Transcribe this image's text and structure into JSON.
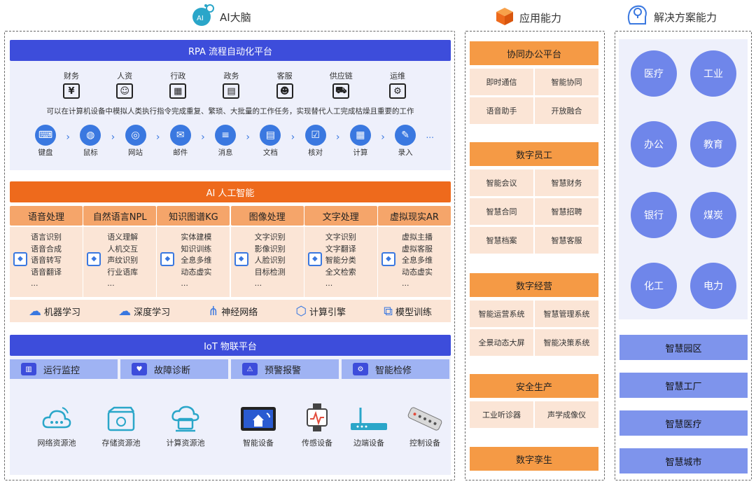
{
  "headers": {
    "ai_brain": "AI大脑",
    "app_capability": "应用能力",
    "solution_capability": "解决方案能力"
  },
  "rpa": {
    "title": "RPA 流程自动化平台",
    "categories": [
      {
        "label": "财务",
        "icon": "finance-icon"
      },
      {
        "label": "人资",
        "icon": "hr-icon"
      },
      {
        "label": "行政",
        "icon": "admin-icon"
      },
      {
        "label": "政务",
        "icon": "government-icon"
      },
      {
        "label": "客服",
        "icon": "customer-service-icon"
      },
      {
        "label": "供应链",
        "icon": "supply-chain-icon"
      },
      {
        "label": "运维",
        "icon": "ops-icon"
      }
    ],
    "description": "可以在计算机设备中模拟人类执行指令完成重复、繁琐、大批量的工作任务，实现替代人工完成枯燥且重要的工作",
    "steps": [
      {
        "label": "键盘",
        "icon": "keyboard-icon"
      },
      {
        "label": "鼠标",
        "icon": "mouse-icon"
      },
      {
        "label": "网站",
        "icon": "globe-icon"
      },
      {
        "label": "邮件",
        "icon": "mail-icon"
      },
      {
        "label": "消息",
        "icon": "message-icon"
      },
      {
        "label": "文档",
        "icon": "document-icon"
      },
      {
        "label": "核对",
        "icon": "checklist-icon"
      },
      {
        "label": "计算",
        "icon": "calculator-icon"
      },
      {
        "label": "录入",
        "icon": "entry-icon"
      }
    ],
    "ellipsis": "..."
  },
  "ai": {
    "title": "AI 人工智能",
    "columns": [
      {
        "head": "语音处理",
        "items": [
          "语言识别",
          "语音合成",
          "语音转写",
          "语音翻译",
          "..."
        ]
      },
      {
        "head": "自然语言NPL",
        "items": [
          "语义理解",
          "人机交互",
          "声纹识别",
          "行业语库",
          "..."
        ]
      },
      {
        "head": "知识图谱KG",
        "items": [
          "实体建模",
          "知识训练",
          "全息多维",
          "动态虚实",
          "..."
        ]
      },
      {
        "head": "图像处理",
        "items": [
          "文字识别",
          "影像识别",
          "人脸识别",
          "目标检测",
          "..."
        ]
      },
      {
        "head": "文字处理",
        "items": [
          "文字识别",
          "文字翻译",
          "智能分类",
          "全文检索",
          "..."
        ]
      },
      {
        "head": "虚拟现实AR",
        "items": [
          "虚拟主播",
          "虚拟客服",
          "全息多维",
          "动态虚实",
          "..."
        ]
      }
    ],
    "ml_row": [
      {
        "label": "机器学习",
        "icon": "brain-icon"
      },
      {
        "label": "深度学习",
        "icon": "deep-learning-icon"
      },
      {
        "label": "神经网络",
        "icon": "network-icon"
      },
      {
        "label": "计算引擎",
        "icon": "engine-icon"
      },
      {
        "label": "模型训练",
        "icon": "cubes-icon"
      }
    ]
  },
  "iot": {
    "title": "IoT 物联平台",
    "tabs": [
      {
        "label": "运行监控",
        "icon": "monitor-icon"
      },
      {
        "label": "故障诊断",
        "icon": "diagnosis-icon"
      },
      {
        "label": "预警报警",
        "icon": "warning-icon"
      },
      {
        "label": "智能检修",
        "icon": "repair-icon"
      }
    ],
    "devices": [
      {
        "label": "网络资源池",
        "icon": "cloud-network-icon"
      },
      {
        "label": "存储资源池",
        "icon": "storage-icon"
      },
      {
        "label": "计算资源池",
        "icon": "compute-cloud-icon"
      },
      {
        "label": "智能设备",
        "icon": "smart-device-icon"
      },
      {
        "label": "传感设备",
        "icon": "sensor-icon"
      },
      {
        "label": "边端设备",
        "icon": "router-icon"
      },
      {
        "label": "控制设备",
        "icon": "remote-icon"
      }
    ]
  },
  "app": {
    "groups": [
      {
        "title": "协同办公平台",
        "items": [
          "即时通信",
          "智能协同",
          "语音助手",
          "开放融合"
        ]
      },
      {
        "title": "数字员工",
        "items": [
          "智能会议",
          "智慧财务",
          "智慧合同",
          "智慧招聘",
          "智慧档案",
          "智慧客服"
        ]
      },
      {
        "title": "数字经营",
        "items": [
          "智能运营系统",
          "智慧管理系统",
          "全景动态大屏",
          "智能决策系统"
        ]
      },
      {
        "title": "安全生产",
        "items": [
          "工业听诊器",
          "声学成像仪"
        ]
      },
      {
        "title": "数字孪生",
        "items": []
      }
    ]
  },
  "solutions": {
    "circles": [
      "医疗",
      "工业",
      "办公",
      "教育",
      "银行",
      "煤炭",
      "化工",
      "电力"
    ],
    "bars": [
      "智慧园区",
      "智慧工厂",
      "智慧医疗",
      "智慧城市"
    ]
  },
  "colors": {
    "blue": "#3d4ddb",
    "orange": "#ee6a1c",
    "light_orange": "#fbe5d6",
    "panel": "#eef0fb"
  }
}
